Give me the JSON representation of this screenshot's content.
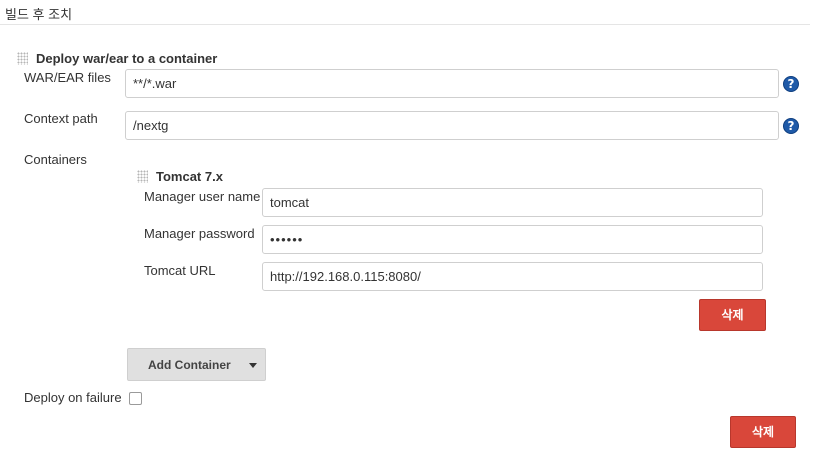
{
  "section": {
    "title": "빌드 후 조치"
  },
  "deploy": {
    "title": "Deploy war/ear to a container",
    "war_label": "WAR/EAR files",
    "war_value": "**/*.war",
    "context_label": "Context path",
    "context_value": "/nextg",
    "containers_label": "Containers"
  },
  "tomcat": {
    "title": "Tomcat 7.x",
    "user_label": "Manager user name",
    "user_value": "tomcat",
    "password_label": "Manager password",
    "password_value": "••••••",
    "url_label": "Tomcat URL",
    "url_value": "http://192.168.0.115:8080/",
    "delete_label": "삭제"
  },
  "add_container": {
    "label": "Add Container"
  },
  "failure": {
    "label": "Deploy on failure",
    "checked": false
  },
  "delete_label": "삭제",
  "help": {
    "glyph": "?"
  },
  "colors": {
    "delete_button": "#d9473a",
    "help_icon": "#1f5aa8",
    "add_button": "#e0e0e0"
  }
}
